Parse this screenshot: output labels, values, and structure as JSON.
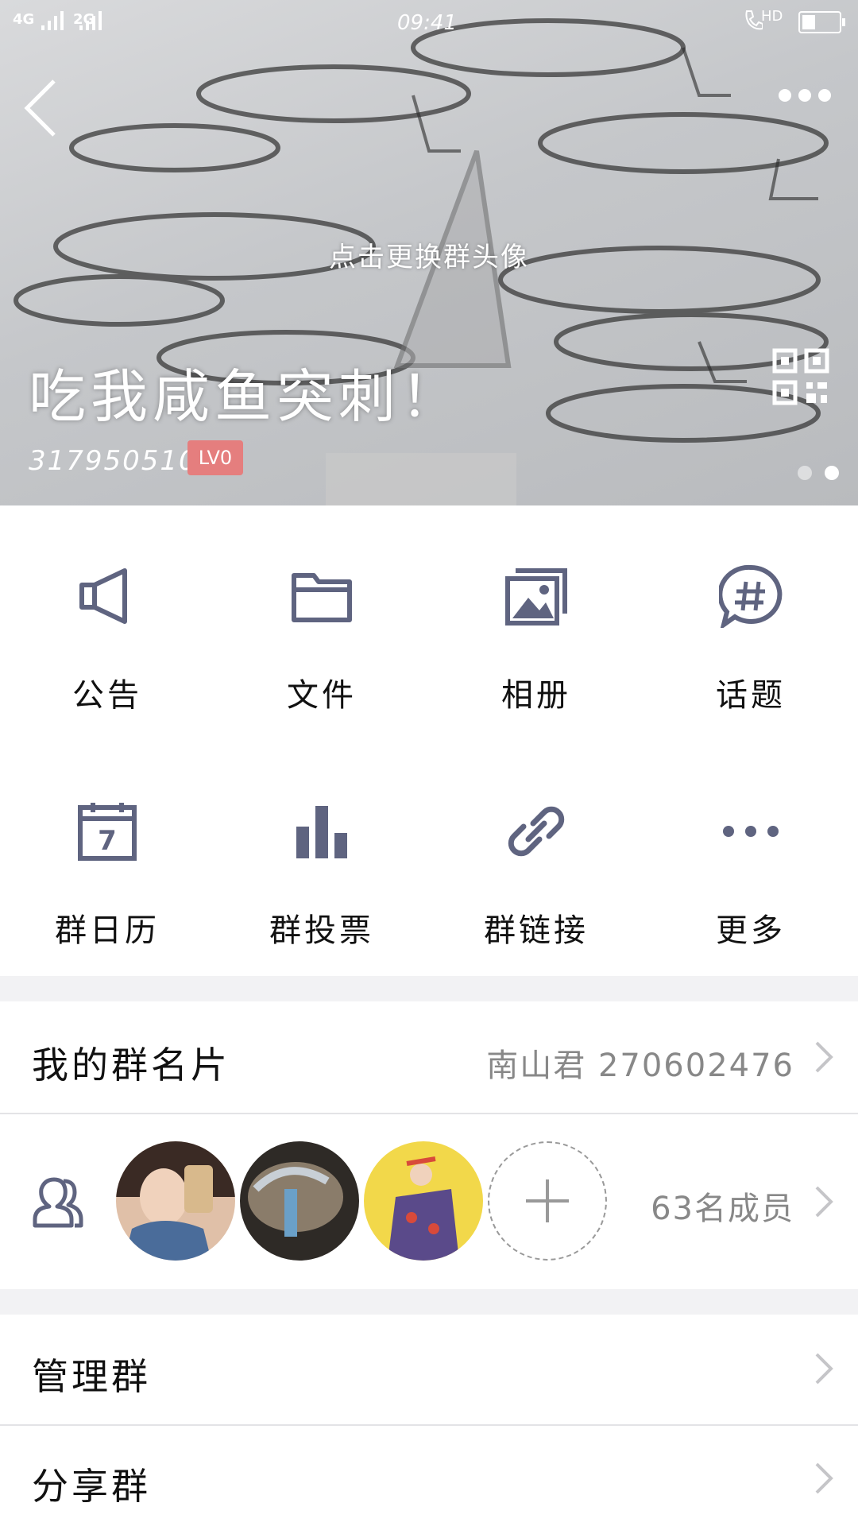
{
  "status_bar": {
    "network_1": "4G",
    "network_2": "2G",
    "time": "09:41",
    "hd": "HD"
  },
  "header": {
    "change_avatar_hint": "点击更换群头像",
    "group_name": "吃我咸鱼突刺！",
    "group_id": "317950510",
    "level_badge": "LV0",
    "page_dots": 2,
    "active_dot": 2
  },
  "grid": {
    "items": [
      {
        "label": "公告",
        "icon": "megaphone-icon"
      },
      {
        "label": "文件",
        "icon": "folder-icon"
      },
      {
        "label": "相册",
        "icon": "album-icon"
      },
      {
        "label": "话题",
        "icon": "topic-hash-icon"
      },
      {
        "label": "群日历",
        "icon": "calendar-icon"
      },
      {
        "label": "群投票",
        "icon": "vote-chart-icon"
      },
      {
        "label": "群链接",
        "icon": "link-icon"
      },
      {
        "label": "更多",
        "icon": "more-dots-icon"
      }
    ],
    "calendar_day": "7"
  },
  "my_card": {
    "title": "我的群名片",
    "value": "南山君 270602476"
  },
  "members": {
    "count_label": "63名成员"
  },
  "manage": {
    "title": "管理群"
  },
  "share": {
    "title": "分享群"
  },
  "colors": {
    "icon": "#5f6480",
    "badge": "#e57e7e"
  }
}
